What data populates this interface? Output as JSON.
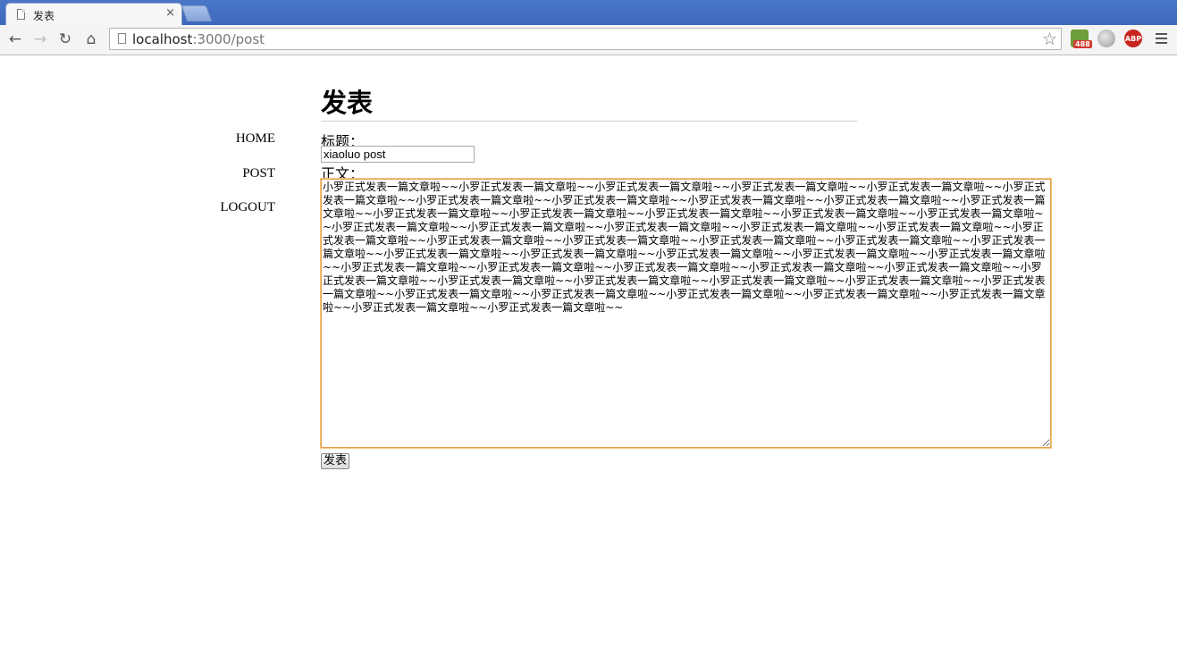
{
  "browser": {
    "tab_title": "发表",
    "tab_close": "×",
    "url_host": "localhost",
    "url_path": ":3000/post",
    "back_icon": "←",
    "forward_icon": "→",
    "reload_icon": "↻",
    "home_icon": "⌂",
    "star_icon": "☆",
    "extension_badge": "488",
    "abp_label": "ABP"
  },
  "sidebar": {
    "items": [
      {
        "label": "HOME"
      },
      {
        "label": "POST"
      },
      {
        "label": "LOGOUT"
      }
    ]
  },
  "main": {
    "page_title": "发表",
    "title_label": "标题：",
    "title_value": "xiaoluo post",
    "content_label": "正文：",
    "content_value": "小罗正式发表一篇文章啦~~小罗正式发表一篇文章啦~~小罗正式发表一篇文章啦~~小罗正式发表一篇文章啦~~小罗正式发表一篇文章啦~~小罗正式发表一篇文章啦~~小罗正式发表一篇文章啦~~小罗正式发表一篇文章啦~~小罗正式发表一篇文章啦~~小罗正式发表一篇文章啦~~小罗正式发表一篇文章啦~~小罗正式发表一篇文章啦~~小罗正式发表一篇文章啦~~小罗正式发表一篇文章啦~~小罗正式发表一篇文章啦~~小罗正式发表一篇文章啦~~小罗正式发表一篇文章啦~~小罗正式发表一篇文章啦~~小罗正式发表一篇文章啦~~小罗正式发表一篇文章啦~~小罗正式发表一篇文章啦~~小罗正式发表一篇文章啦~~小罗正式发表一篇文章啦~~小罗正式发表一篇文章啦~~小罗正式发表一篇文章啦~~小罗正式发表一篇文章啦~~小罗正式发表一篇文章啦~~小罗正式发表一篇文章啦~~小罗正式发表一篇文章啦~~小罗正式发表一篇文章啦~~小罗正式发表一篇文章啦~~小罗正式发表一篇文章啦~~小罗正式发表一篇文章啦~~小罗正式发表一篇文章啦~~小罗正式发表一篇文章啦~~小罗正式发表一篇文章啦~~小罗正式发表一篇文章啦~~小罗正式发表一篇文章啦~~小罗正式发表一篇文章啦~~小罗正式发表一篇文章啦~~小罗正式发表一篇文章啦~~小罗正式发表一篇文章啦~~小罗正式发表一篇文章啦~~小罗正式发表一篇文章啦~~小罗正式发表一篇文章啦~~小罗正式发表一篇文章啦~~小罗正式发表一篇文章啦~~小罗正式发表一篇文章啦~~小罗正式发表一篇文章啦~~小罗正式发表一篇文章啦~~",
    "submit_label": "发表"
  },
  "colors": {
    "tabbar": "#4a76c9",
    "focus_border": "#e5a34a"
  }
}
